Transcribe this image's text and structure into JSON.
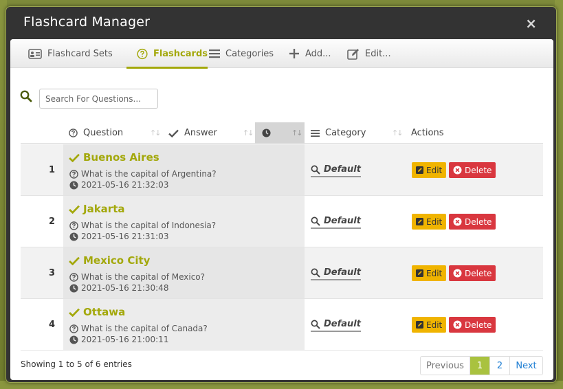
{
  "window": {
    "title": "Flashcard Manager",
    "close_symbol": "×"
  },
  "tabs": [
    {
      "label": "Flashcard Sets",
      "icon": "id-card-icon",
      "active": false
    },
    {
      "label": "Flashcards",
      "icon": "question-circle-icon",
      "active": true
    },
    {
      "label": "Categories",
      "icon": "list-icon",
      "active": false
    },
    {
      "label": "Add...",
      "icon": "plus-icon",
      "active": false
    },
    {
      "label": "Edit...",
      "icon": "edit-icon",
      "active": false
    }
  ],
  "search": {
    "placeholder": "Search For Questions..."
  },
  "table": {
    "columns": {
      "question": "Question",
      "answer": "Answer",
      "time": "",
      "category": "Category",
      "actions": "Actions"
    },
    "rows": [
      {
        "num": "1",
        "answer": "Buenos Aires",
        "question": "What is the capital of Argentina?",
        "timestamp": "2021-05-16 21:32:03",
        "category": "Default",
        "edit": "Edit",
        "delete": "Delete"
      },
      {
        "num": "2",
        "answer": "Jakarta",
        "question": "What is the capital of Indonesia?",
        "timestamp": "2021-05-16 21:31:03",
        "category": "Default",
        "edit": "Edit",
        "delete": "Delete"
      },
      {
        "num": "3",
        "answer": "Mexico City",
        "question": "What is the capital of Mexico?",
        "timestamp": "2021-05-16 21:30:48",
        "category": "Default",
        "edit": "Edit",
        "delete": "Delete"
      },
      {
        "num": "4",
        "answer": "Ottawa",
        "question": "What is the capital of Canada?",
        "timestamp": "2021-05-16 21:00:11",
        "category": "Default",
        "edit": "Edit",
        "delete": "Delete"
      }
    ]
  },
  "footer": {
    "info": "Showing 1 to 5 of 6 entries",
    "pager": {
      "previous": "Previous",
      "current": "1",
      "page2": "2",
      "next": "Next"
    }
  },
  "colors": {
    "accent": "#a3a80b",
    "edit": "#f0b400",
    "delete": "#d9373f",
    "page_active": "#a9c23f",
    "link": "#1e7ed3"
  }
}
